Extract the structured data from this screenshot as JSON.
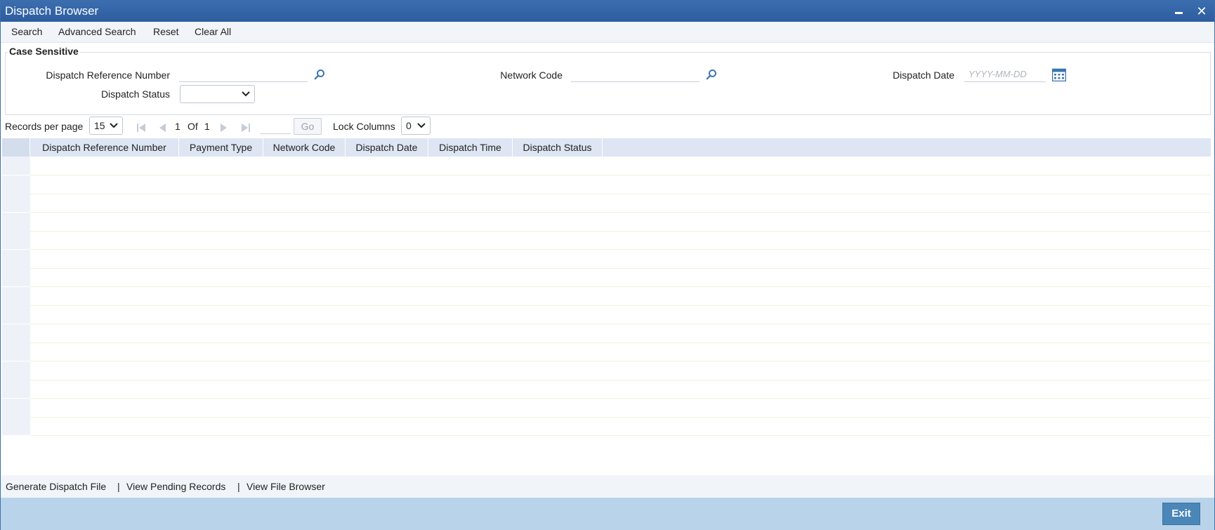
{
  "window": {
    "title": "Dispatch Browser"
  },
  "menu": {
    "search": "Search",
    "advanced_search": "Advanced Search",
    "reset": "Reset",
    "clear_all": "Clear All"
  },
  "criteria": {
    "legend": "Case Sensitive",
    "dispatch_ref_label": "Dispatch Reference Number",
    "dispatch_ref_value": "",
    "network_code_label": "Network Code",
    "network_code_value": "",
    "dispatch_date_label": "Dispatch Date",
    "dispatch_date_placeholder": "YYYY-MM-DD",
    "dispatch_status_label": "Dispatch Status",
    "dispatch_status_value": ""
  },
  "pager": {
    "records_per_page_label": "Records per page",
    "records_per_page": "15",
    "page": "1",
    "of_label": "Of",
    "total_pages": "1",
    "go_label": "Go",
    "lock_columns_label": "Lock Columns",
    "lock_columns": "0"
  },
  "grid": {
    "columns": [
      "Dispatch Reference Number",
      "Payment Type",
      "Network Code",
      "Dispatch Date",
      "Dispatch Time",
      "Dispatch Status"
    ],
    "rows": []
  },
  "footer": {
    "generate": "Generate Dispatch File",
    "sep": "|",
    "pending": "View Pending Records",
    "file_browser": "View File Browser",
    "exit": "Exit"
  },
  "colors": {
    "title_bar": "#2d5d9e",
    "header_row": "#dde6f2",
    "bottom_bar": "#b9d4ea",
    "exit_button": "#4a86b8",
    "accent_icon": "#3d74b3"
  }
}
